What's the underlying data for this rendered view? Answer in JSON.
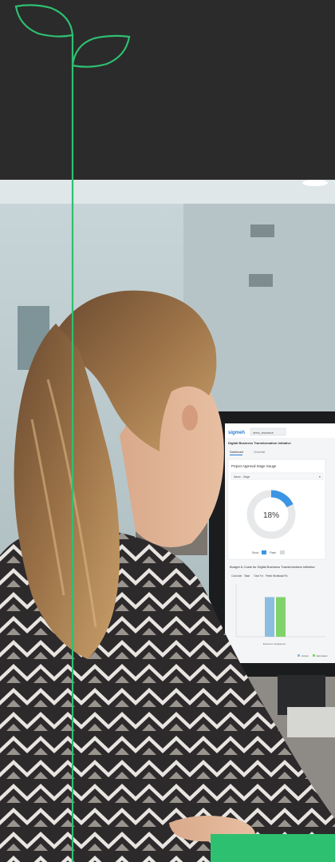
{
  "colors": {
    "header_bg": "#2b2b2b",
    "brand_green": "#2ec071",
    "chart_bar_actual": "#8bbde0",
    "chart_bar_estimated": "#7fd36a",
    "gauge_blue": "#3b95e3"
  },
  "icons": {
    "sprout": "sprout-icon"
  },
  "monitor": {
    "app_logo": "sigmeh",
    "search_value": "demo_insurance",
    "page_title": "Digital Business Transformation Initiative",
    "tabs": [
      {
        "label": "Dashboard"
      },
      {
        "label": "Checklist"
      }
    ],
    "gauge_panel": {
      "title": "Project Approval Stage Gauge",
      "select_value": "Name - Stage",
      "gauge_value": "18%",
      "gauge_fraction": 0.18,
      "legend_left": "Stuck",
      "legend_right": "Flash"
    },
    "budget_panel": {
      "title": "Budget & Costs for Digital Business Transformation Initiative",
      "filter_label": "Calculate",
      "filter_value": "Total",
      "scope_label": "Total For",
      "scope_value": "Fresh Workload Fix",
      "chart_data": {
        "type": "bar",
        "categories": [
          "Business Intelligence"
        ],
        "series": [
          {
            "name": "Actual",
            "values": [
              0.8
            ]
          },
          {
            "name": "Estimated",
            "values": [
              0.8
            ]
          }
        ],
        "ylim": [
          0,
          1
        ]
      }
    }
  }
}
